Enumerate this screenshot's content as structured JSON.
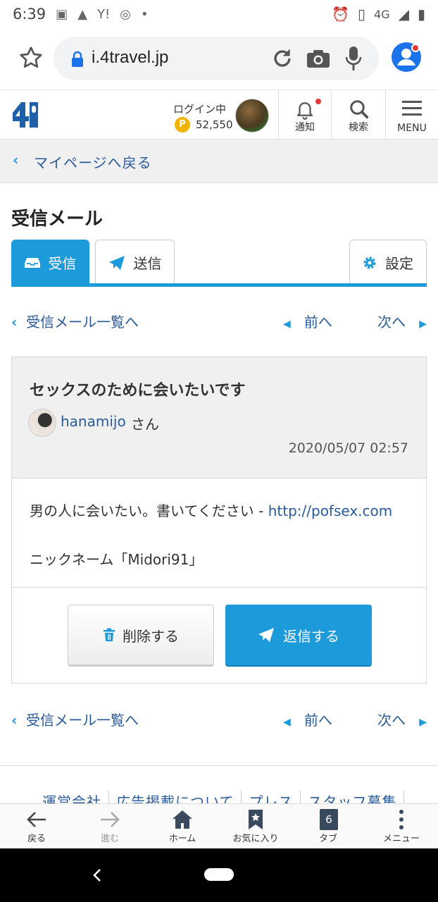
{
  "status_bar": {
    "time": "6:39",
    "network": "4G"
  },
  "browser": {
    "url": "i.4travel.jp"
  },
  "site_header": {
    "login_label": "ログイン中",
    "coin_symbol": "P",
    "points": "52,550",
    "notify_label": "通知",
    "search_label": "検索",
    "menu_label": "MENU"
  },
  "back_link": "マイページへ戻る",
  "page_title": "受信メール",
  "tabs": {
    "inbox": "受信",
    "sent": "送信",
    "settings": "設定"
  },
  "pager": {
    "list_link": "受信メール一覧へ",
    "prev": "前へ",
    "next": "次へ"
  },
  "mail": {
    "subject": "セックスのために会いたいです",
    "sender": "hanamijo",
    "sender_suffix": "さん",
    "date": "2020/05/07 02:57",
    "body_text": "男の人に会いたい。書いてください - ",
    "body_link": "http://pofsex.com",
    "body_line2": "ニックネーム「Midori91」"
  },
  "actions": {
    "delete": "削除する",
    "reply": "返信する"
  },
  "footer_links": [
    "運営会社",
    "広告掲載について",
    "プレス",
    "スタッフ募集"
  ],
  "bottom_bar": {
    "back": "戻る",
    "forward": "進む",
    "home": "ホーム",
    "favorites": "お気に入り",
    "tabs": "タブ",
    "tab_count": "6",
    "menu": "メニュー"
  },
  "colors": {
    "accent": "#1c9ad9",
    "link": "#2a5a9a",
    "coin": "#f0b400"
  }
}
